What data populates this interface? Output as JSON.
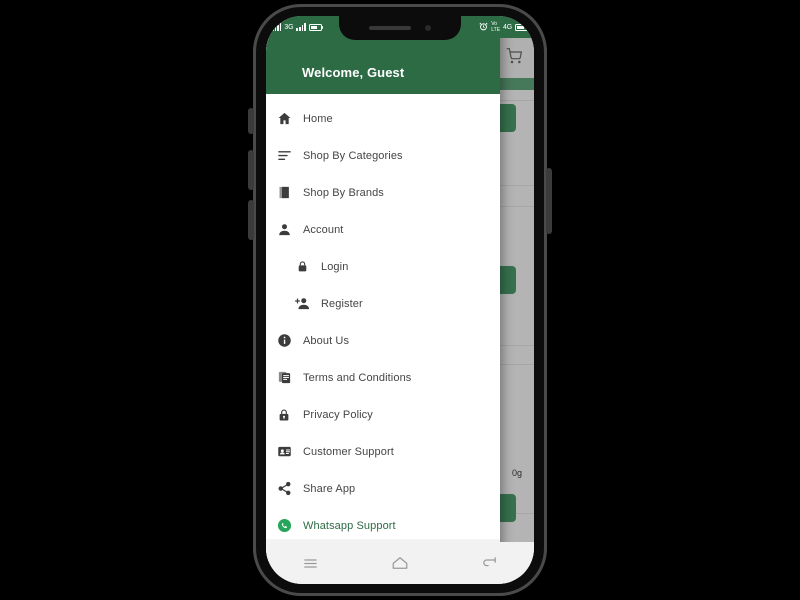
{
  "device": {
    "status_bar": {
      "network_label": "3G",
      "volte_line1": "Vo",
      "volte_line2": "LTE",
      "data_label": "4G"
    },
    "nav_bar": {
      "recents_label": "recents-icon",
      "home_label": "home-icon",
      "back_label": "back-icon"
    }
  },
  "drawer": {
    "title": "Welcome, Guest",
    "header_color": "#2d6b45",
    "items": [
      {
        "label": "Home",
        "icon": "home-icon",
        "sub": false,
        "highlight": false
      },
      {
        "label": "Shop By Categories",
        "icon": "list-icon",
        "sub": false,
        "highlight": false
      },
      {
        "label": "Shop By Brands",
        "icon": "layers-icon",
        "sub": false,
        "highlight": false
      },
      {
        "label": "Account",
        "icon": "person-icon",
        "sub": false,
        "highlight": false
      },
      {
        "label": "Login",
        "icon": "lock-icon",
        "sub": true,
        "highlight": false
      },
      {
        "label": "Register",
        "icon": "person-add-icon",
        "sub": true,
        "highlight": false
      },
      {
        "label": "About Us",
        "icon": "info-icon",
        "sub": false,
        "highlight": false
      },
      {
        "label": "Terms and Conditions",
        "icon": "document-copy-icon",
        "sub": false,
        "highlight": false
      },
      {
        "label": "Privacy Policy",
        "icon": "privacy-lock-icon",
        "sub": false,
        "highlight": false
      },
      {
        "label": "Customer Support",
        "icon": "contact-card-icon",
        "sub": false,
        "highlight": false
      },
      {
        "label": "Share App",
        "icon": "share-icon",
        "sub": false,
        "highlight": false
      },
      {
        "label": "Whatsapp Support",
        "icon": "whatsapp-icon",
        "sub": false,
        "highlight": true
      }
    ]
  },
  "background_page": {
    "appbar_icons": [
      "notification-bell-icon",
      "shopping-cart-icon"
    ],
    "product_weight": "0g",
    "accent_color": "#2d6b45"
  }
}
